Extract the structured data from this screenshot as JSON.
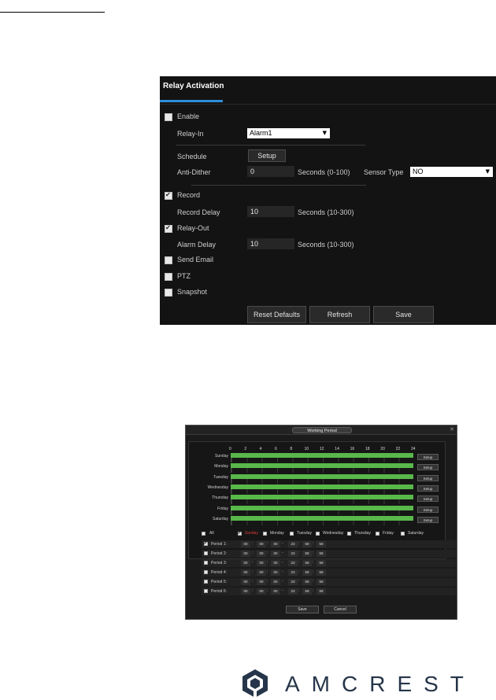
{
  "relay": {
    "title": "Relay Activation",
    "enable_label": "Enable",
    "enable_checked": false,
    "relay_in_label": "Relay-In",
    "relay_in_value": "Alarm1",
    "schedule_label": "Schedule",
    "setup_label": "Setup",
    "anti_dither_label": "Anti-Dither",
    "anti_dither_value": "0",
    "anti_dither_unit": "Seconds (0-100)",
    "sensor_type_label": "Sensor Type",
    "sensor_type_value": "NO",
    "record_label": "Record",
    "record_checked": true,
    "record_delay_label": "Record Delay",
    "record_delay_value": "10",
    "record_delay_unit": "Seconds (10-300)",
    "relay_out_label": "Relay-Out",
    "relay_out_checked": true,
    "alarm_delay_label": "Alarm Delay",
    "alarm_delay_value": "10",
    "alarm_delay_unit": "Seconds (10-300)",
    "send_email_label": "Send Email",
    "ptz_label": "PTZ",
    "snapshot_label": "Snapshot",
    "reset_label": "Reset Defaults",
    "refresh_label": "Refresh",
    "save_label": "Save"
  },
  "working_period": {
    "title": "Working Period",
    "close_icon": "close-icon",
    "hours": [
      "0",
      "2",
      "4",
      "6",
      "8",
      "10",
      "12",
      "14",
      "16",
      "18",
      "20",
      "22",
      "24"
    ],
    "days": [
      "Sunday",
      "Monday",
      "Tuesday",
      "Wednesday",
      "Thursday",
      "Friday",
      "Saturday"
    ],
    "setup_label": "Setup",
    "all_label": "All",
    "day_options": [
      "Sunday",
      "Monday",
      "Tuesday",
      "Wednesday",
      "Thursday",
      "Friday",
      "Saturday"
    ],
    "periods": [
      {
        "label": "Period 1:",
        "checked": true,
        "start": [
          "00",
          "00",
          "00"
        ],
        "end": [
          "23",
          "59",
          "59"
        ]
      },
      {
        "label": "Period 2:",
        "checked": false,
        "start": [
          "00",
          "00",
          "00"
        ],
        "end": [
          "23",
          "59",
          "59"
        ]
      },
      {
        "label": "Period 3:",
        "checked": false,
        "start": [
          "00",
          "00",
          "00"
        ],
        "end": [
          "23",
          "59",
          "59"
        ]
      },
      {
        "label": "Period 4:",
        "checked": false,
        "start": [
          "00",
          "00",
          "00"
        ],
        "end": [
          "23",
          "59",
          "59"
        ]
      },
      {
        "label": "Period 5:",
        "checked": false,
        "start": [
          "00",
          "00",
          "00"
        ],
        "end": [
          "23",
          "59",
          "59"
        ]
      },
      {
        "label": "Period 6:",
        "checked": false,
        "start": [
          "00",
          "00",
          "00"
        ],
        "end": [
          "23",
          "59",
          "59"
        ]
      }
    ],
    "save_label": "Save",
    "cancel_label": "Cancel"
  },
  "logo": {
    "brand": "AMCREST",
    "brand_color": "#263549"
  },
  "colors": {
    "accent": "#2f8fdb",
    "schedule_bar": "#59b84a",
    "selected_day": "#e03b3b"
  }
}
